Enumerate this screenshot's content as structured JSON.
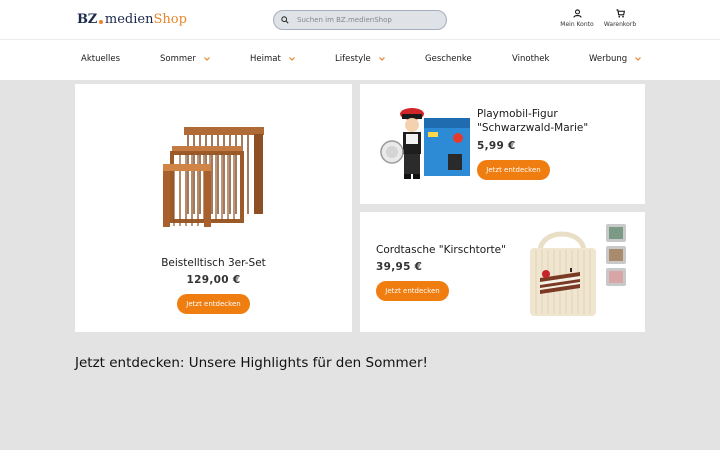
{
  "header": {
    "logo": {
      "part1": "BZ",
      "part2": "medien",
      "part3": "Shop"
    },
    "search": {
      "placeholder": "Suchen im BZ.medienShop"
    },
    "account_label": "Mein Konto",
    "cart_label": "Warenkorb"
  },
  "nav": {
    "items": [
      {
        "label": "Aktuelles"
      },
      {
        "label": "Sommer"
      },
      {
        "label": "Heimat"
      },
      {
        "label": "Lifestyle"
      },
      {
        "label": "Geschenke"
      },
      {
        "label": "Vinothek"
      },
      {
        "label": "Werbung"
      }
    ]
  },
  "products": [
    {
      "title": "Beistelltisch 3er-Set",
      "price": "129,00 €",
      "button": "Jetzt entdecken"
    },
    {
      "title_line1": "Playmobil-Figur",
      "title_line2": "\"Schwarzwald-Marie\"",
      "price": "5,99 €",
      "button": "Jetzt entdecken"
    },
    {
      "title": "Cordtasche \"Kirschtorte\"",
      "price": "39,95 €",
      "button": "Jetzt entdecken"
    }
  ],
  "headline": "Jetzt entdecken: Unsere Highlights für den Sommer!",
  "colors": {
    "accent": "#ef7d0f",
    "brand_dark": "#1a2a48",
    "background": "#e3e3e3"
  }
}
